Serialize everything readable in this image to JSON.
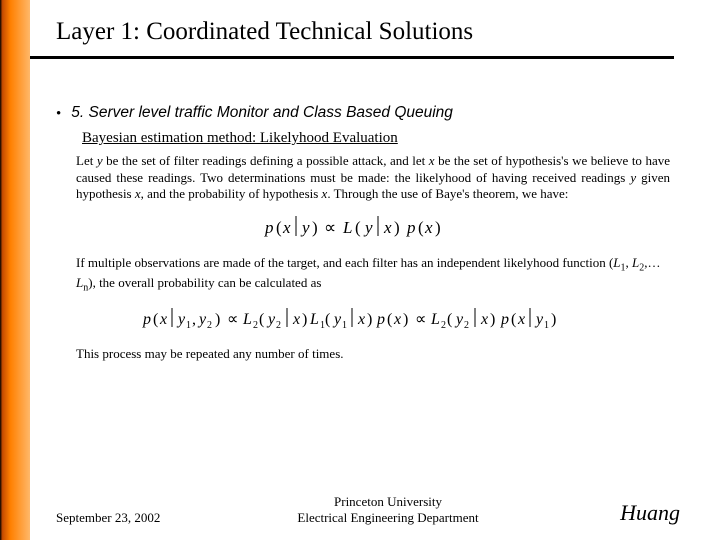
{
  "title": "Layer 1: Coordinated Technical Solutions",
  "bullet": {
    "marker": "•",
    "text": "5. Server level traffic Monitor and Class Based Queuing"
  },
  "subheading": "Bayesian estimation method: Likelyhood Evaluation",
  "para1_parts": {
    "a": "Let ",
    "y1": "y",
    "b": " be the set of filter readings defining a possible attack, and let ",
    "x1": "x",
    "c": " be the set of hypothesis's we believe to have caused these readings. Two determinations must be made: the likelyhood of having received readings ",
    "y2": "y",
    "d": " given hypothesis ",
    "x2": "x",
    "e": ", and the probability of hypothesis ",
    "x3": "x",
    "f": ". Through the use of Baye's theorem, we have:"
  },
  "eq1": {
    "p1": "p",
    "open1": "(",
    "x1": "x",
    "bar1": "|",
    "y1": "y",
    "close1": ")",
    "prop": "∝",
    "L": "L",
    "open2": "(",
    "y2": "y",
    "bar2": "|",
    "x2": "x",
    "close2": ")",
    "p2": "p",
    "open3": "(",
    "x3": "x",
    "close3": ")"
  },
  "para2_parts": {
    "a": "If multiple observations are made of the target, and each filter has an independent likelyhood function (",
    "L1": "L",
    "s1": "1",
    "comma1": ", ",
    "L2": "L",
    "s2": "2",
    "comma2": ",…",
    "Ln": "L",
    "sn": "n",
    "b": "), the overall probability can be calculated as"
  },
  "eq2": {
    "t": [
      "p",
      "(",
      "x",
      "|",
      "y",
      "1",
      ",",
      "y",
      "2",
      ")",
      "∝",
      "L",
      "2",
      "(",
      "y",
      "2",
      "|",
      "x",
      ")",
      "L",
      "1",
      "(",
      "y",
      "1",
      "|",
      "x",
      ")",
      "p",
      "(",
      "x",
      ")",
      "∝",
      "L",
      "2",
      "(",
      "y",
      "2",
      "|",
      "x",
      ")",
      "p",
      "(",
      "x",
      "|",
      "y",
      "1",
      ")"
    ]
  },
  "para3": "This process may be repeated any number of times.",
  "footer": {
    "date": "September 23, 2002",
    "inst_line1": "Princeton University",
    "inst_line2": "Electrical Engineering Department",
    "author": "Huang"
  }
}
